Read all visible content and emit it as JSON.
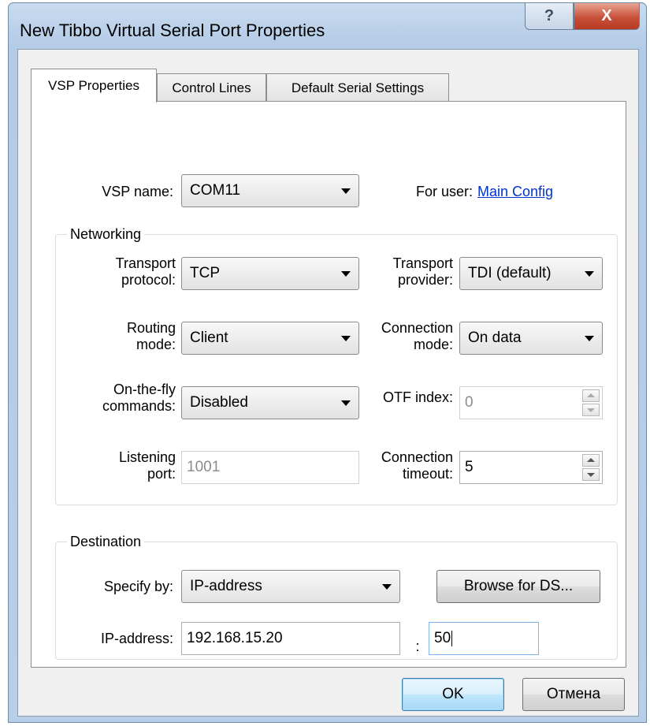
{
  "window": {
    "title": "New Tibbo Virtual Serial Port Properties",
    "help_glyph": "?",
    "close_glyph": "X"
  },
  "tabs": [
    {
      "label": "VSP Properties",
      "active": true
    },
    {
      "label": "Control Lines",
      "active": false
    },
    {
      "label": "Default Serial Settings",
      "active": false
    }
  ],
  "vsp": {
    "name_label": "VSP name:",
    "name_value": "COM11",
    "for_user_label": "For user:",
    "for_user_link": "Main Config"
  },
  "networking": {
    "group_title": "Networking",
    "transport_protocol_label_1": "Transport",
    "transport_protocol_label_2": "protocol:",
    "transport_protocol_value": "TCP",
    "transport_provider_label_1": "Transport",
    "transport_provider_label_2": "provider:",
    "transport_provider_value": "TDI (default)",
    "routing_mode_label_1": "Routing",
    "routing_mode_label_2": "mode:",
    "routing_mode_value": "Client",
    "connection_mode_label_1": "Connection",
    "connection_mode_label_2": "mode:",
    "connection_mode_value": "On data",
    "otf_commands_label_1": "On-the-fly",
    "otf_commands_label_2": "commands:",
    "otf_commands_value": "Disabled",
    "otf_index_label": "OTF index:",
    "otf_index_value": "0",
    "listening_port_label_1": "Listening",
    "listening_port_label_2": "port:",
    "listening_port_value": "1001",
    "connection_timeout_label_1": "Connection",
    "connection_timeout_label_2": "timeout:",
    "connection_timeout_value": "5"
  },
  "destination": {
    "group_title": "Destination",
    "specify_by_label": "Specify by:",
    "specify_by_value": "IP-address",
    "browse_button": "Browse for DS...",
    "ip_label": "IP-address:",
    "ip_value": "192.168.15.20",
    "port_separator": ":",
    "port_value": "50"
  },
  "footer": {
    "ok_button": "OK",
    "cancel_button": "Отмена"
  },
  "colors": {
    "link": "#0033cc",
    "close_button": "#c8513a",
    "default_button_border": "#3c7fb1"
  }
}
